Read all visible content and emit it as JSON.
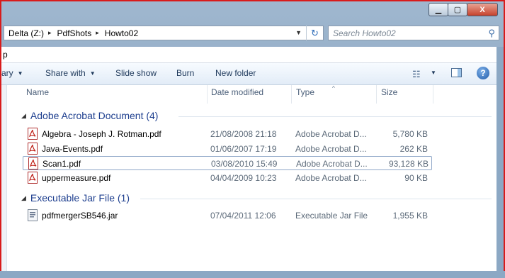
{
  "address": {
    "crumbs": [
      "Delta (Z:)",
      "PdfShots",
      "Howto02"
    ],
    "separator": "▸",
    "dropdown": "▼",
    "refresh_icon": "refresh-icon"
  },
  "search": {
    "placeholder": "Search Howto02",
    "icon": "magnifier-icon"
  },
  "menubar": {
    "partial_label": "p"
  },
  "toolbar": {
    "organize_partial": "ary",
    "share": "Share with",
    "slideshow": "Slide show",
    "burn": "Burn",
    "newfolder": "New folder",
    "arrow": "▼"
  },
  "columns": {
    "name": "Name",
    "date": "Date modified",
    "type": "Type",
    "size": "Size",
    "sort_indicator": "^"
  },
  "groups": [
    {
      "title": "Adobe Acrobat Document (4)",
      "files": [
        {
          "name": "Algebra - Joseph J. Rotman.pdf",
          "date": "21/08/2008 21:18",
          "type": "Adobe Acrobat D...",
          "size": "5,780 KB",
          "icon": "pdf-icon"
        },
        {
          "name": "Java-Events.pdf",
          "date": "01/06/2007 17:19",
          "type": "Adobe Acrobat D...",
          "size": "262 KB",
          "icon": "pdf-icon"
        },
        {
          "name": "Scan1.pdf",
          "date": "03/08/2010 15:49",
          "type": "Adobe Acrobat D...",
          "size": "93,128 KB",
          "icon": "pdf-icon",
          "selected": true
        },
        {
          "name": "uppermeasure.pdf",
          "date": "04/04/2009 10:23",
          "type": "Adobe Acrobat D...",
          "size": "90 KB",
          "icon": "pdf-icon"
        }
      ]
    },
    {
      "title": "Executable Jar File (1)",
      "files": [
        {
          "name": "pdfmergerSB546.jar",
          "date": "07/04/2011 12:06",
          "type": "Executable Jar File",
          "size": "1,955 KB",
          "icon": "jar-icon"
        }
      ]
    }
  ],
  "window": {
    "minimize": "▁",
    "maximize": "▢",
    "close": "X"
  },
  "colors": {
    "group": "#1e3f8f",
    "frame": "#d81b1b",
    "selection_border": "#8fa7c8"
  }
}
